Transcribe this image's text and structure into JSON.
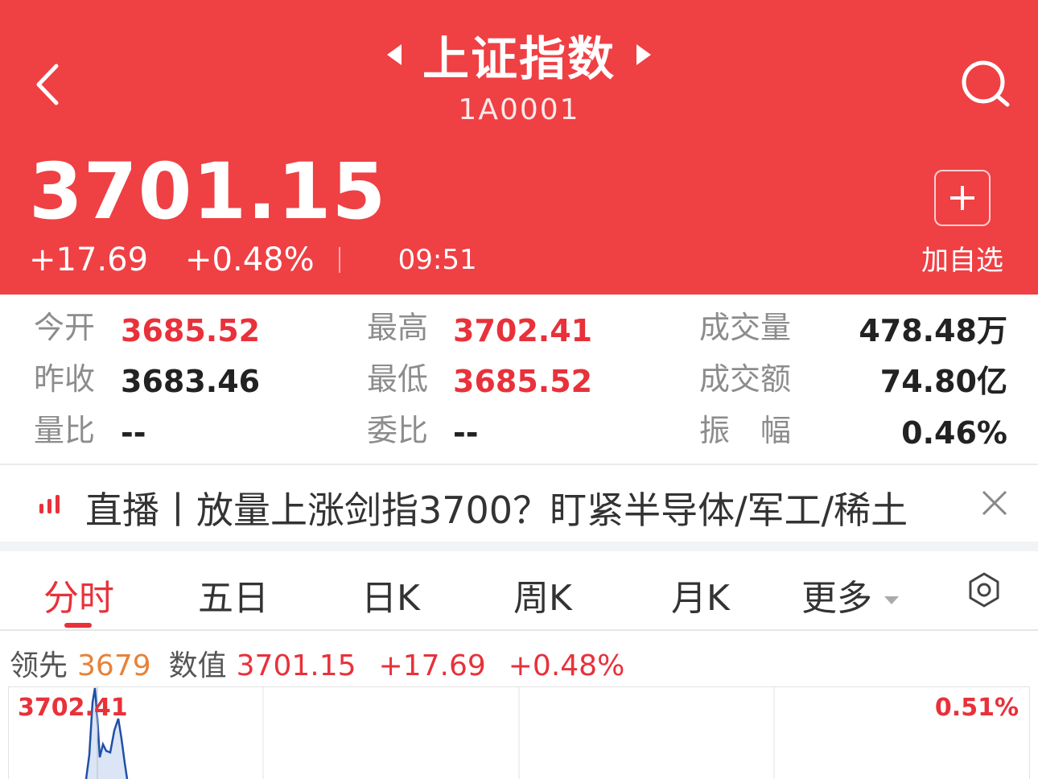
{
  "header": {
    "title": "上证指数",
    "code": "1A0001",
    "price": "3701.15",
    "change": "+17.69",
    "change_pct": "+0.48%",
    "time": "09:51",
    "add_label": "加自选",
    "bg_color": "#ef4044",
    "icons": {
      "back": "chevron-left-icon",
      "search": "search-icon",
      "prev": "triangle-left-icon",
      "next": "triangle-right-icon",
      "add": "plus-icon"
    }
  },
  "stats": {
    "open_label": "今开",
    "open_value": "3685.52",
    "high_label": "最高",
    "high_value": "3702.41",
    "volume_label": "成交量",
    "volume_value": "478.48万",
    "prev_close_label": "昨收",
    "prev_close_value": "3683.46",
    "low_label": "最低",
    "low_value": "3685.52",
    "amount_label": "成交额",
    "amount_value": "74.80亿",
    "volume_ratio_label": "量比",
    "volume_ratio_value": "--",
    "order_ratio_label": "委比",
    "order_ratio_value": "--",
    "amplitude_label": "振　幅",
    "amplitude_value": "0.46%"
  },
  "live": {
    "text": "直播丨放量上涨剑指3700？盯紧半导体/军工/稀土",
    "icon": "live-bars-icon",
    "close_icon": "close-icon"
  },
  "tabs": {
    "items": [
      "分时",
      "五日",
      "日K",
      "周K",
      "月K",
      "更多"
    ],
    "active": "分时",
    "settings_icon": "settings-hexagon-icon"
  },
  "indicator": {
    "lead_label": "领先",
    "lead_value": "3679",
    "value_label": "数值",
    "value": "3701.15",
    "change": "+17.69",
    "change_pct": "+0.48%"
  },
  "chart": {
    "top_left_label": "3702.41",
    "top_right_label": "0.51%"
  },
  "colors": {
    "accent_red": "#e8313a",
    "orange": "#e6833a",
    "chart_line": "#1f4fa8"
  }
}
